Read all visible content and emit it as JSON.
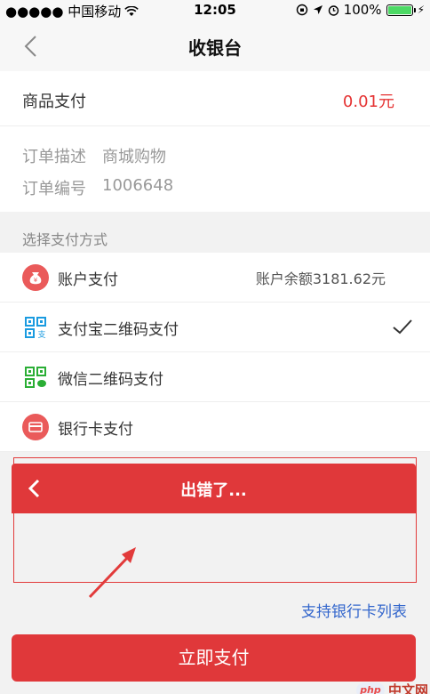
{
  "status_bar": {
    "carrier": "●●●●● 中国移动",
    "time": "12:05",
    "battery": "100%"
  },
  "nav": {
    "title": "收银台"
  },
  "product": {
    "label": "商品支付",
    "amount": "0.01元"
  },
  "order": {
    "desc_label": "订单描述",
    "desc_value": "商城购物",
    "number_label": "订单编号",
    "number_value": "1006648"
  },
  "payment": {
    "section_label": "选择支付方式",
    "methods": [
      {
        "label": "账户支付",
        "extra": "账户余额3181.62元",
        "icon": "money-bag-icon"
      },
      {
        "label": "支付宝二维码支付",
        "selected": true,
        "icon": "alipay-qr-icon"
      },
      {
        "label": "微信二维码支付",
        "icon": "wechat-qr-icon"
      },
      {
        "label": "银行卡支付",
        "icon": "bank-card-icon"
      }
    ]
  },
  "error_panel": {
    "title": "出错了..."
  },
  "links": {
    "bank_list": "支持银行卡列表"
  },
  "actions": {
    "pay_now": "立即支付"
  },
  "watermark": {
    "php": "php",
    "site": "中文网"
  },
  "colors": {
    "accent_red": "#e0383a",
    "amount_red": "#e53333",
    "link_blue": "#3366cc",
    "alipay_blue": "#1a9be0",
    "wechat_green": "#2aae35"
  }
}
